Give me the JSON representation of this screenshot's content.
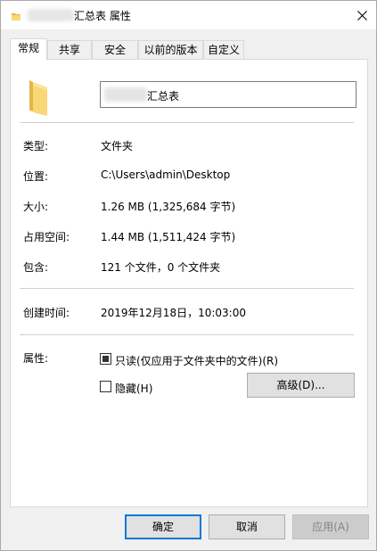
{
  "titlebar": {
    "title": "汇总表 属性",
    "icon": "folder-icon",
    "close": "close-icon"
  },
  "tabs": [
    {
      "label": "常规",
      "active": true
    },
    {
      "label": "共享"
    },
    {
      "label": "安全"
    },
    {
      "label": "以前的版本"
    },
    {
      "label": "自定义"
    }
  ],
  "general": {
    "name_value": "汇总表",
    "rows": [
      {
        "label": "类型:",
        "value": "文件夹"
      },
      {
        "label": "位置:",
        "value": "C:\\Users\\admin\\Desktop"
      },
      {
        "label": "大小:",
        "value": "1.26 MB (1,325,684 字节)"
      },
      {
        "label": "占用空间:",
        "value": "1.44 MB (1,511,424 字节)"
      },
      {
        "label": "包含:",
        "value": "121 个文件，0 个文件夹"
      },
      {
        "label": "创建时间:",
        "value": "2019年12月18日，10:03:00"
      }
    ],
    "attributes_label": "属性:",
    "readonly_label": "只读(仅应用于文件夹中的文件)(R)",
    "readonly_state": "indeterminate",
    "hidden_label": "隐藏(H)",
    "hidden_state": "unchecked",
    "advanced_label": "高级(D)..."
  },
  "footer": {
    "ok": "确定",
    "cancel": "取消",
    "apply": "应用(A)"
  },
  "colors": {
    "accent": "#0078d7",
    "folder": "#f8d775",
    "folder_dark": "#e4b548"
  }
}
